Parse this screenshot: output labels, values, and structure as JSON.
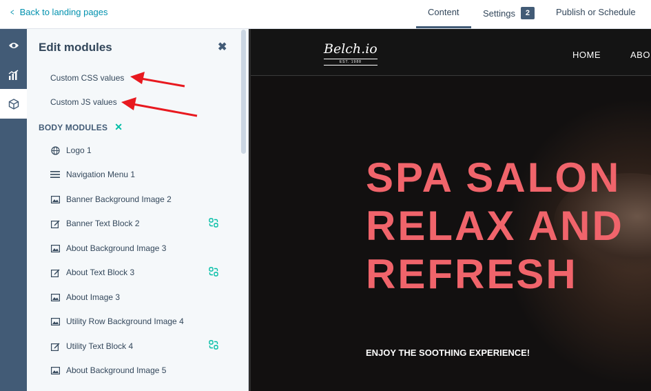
{
  "topbar": {
    "back_label": "Back to landing pages",
    "tabs": {
      "content": "Content",
      "settings": "Settings",
      "settings_badge": "2",
      "publish": "Publish or Schedule"
    }
  },
  "rail": {
    "items": [
      "eye-icon",
      "chart-icon",
      "cube-icon"
    ],
    "active": "cube-icon"
  },
  "panel": {
    "title": "Edit modules",
    "links": [
      "Custom CSS values",
      "Custom JS values"
    ],
    "section_label": "BODY MODULES",
    "modules": [
      {
        "label": "Logo 1",
        "icon": "globe-icon",
        "global": false
      },
      {
        "label": "Navigation Menu 1",
        "icon": "menu-icon",
        "global": false
      },
      {
        "label": "Banner Background Image 2",
        "icon": "image-icon",
        "global": false
      },
      {
        "label": "Banner Text Block 2",
        "icon": "edit-icon",
        "global": true
      },
      {
        "label": "About Background Image 3",
        "icon": "image-icon",
        "global": false
      },
      {
        "label": "About Text Block 3",
        "icon": "edit-icon",
        "global": true
      },
      {
        "label": "About Image 3",
        "icon": "image-icon",
        "global": false
      },
      {
        "label": "Utility Row Background Image 4",
        "icon": "image-icon",
        "global": false
      },
      {
        "label": "Utility Text Block 4",
        "icon": "edit-icon",
        "global": true
      },
      {
        "label": "About Background Image 5",
        "icon": "image-icon",
        "global": false
      }
    ]
  },
  "preview": {
    "logo_text": "Belch.io",
    "logo_sub": "EST. 1988",
    "nav": [
      "HOME",
      "ABO"
    ],
    "hero_lines": [
      "SPA SALON",
      "RELAX AND",
      "REFRESH"
    ],
    "hero_sub": "ENJOY THE SOOTHING EXPERIENCE!"
  },
  "colors": {
    "accent_link": "#0091ae",
    "rail": "#425b76",
    "hero_text": "#f0646b",
    "annotation_arrow": "#e8191f",
    "global_icon": "#00bda5"
  }
}
